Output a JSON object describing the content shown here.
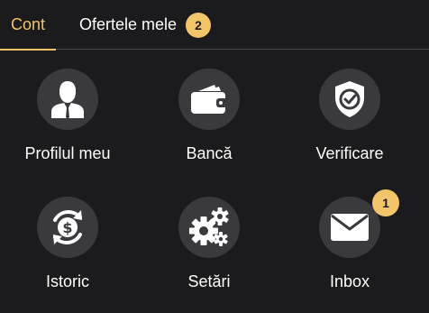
{
  "tabs": {
    "active": {
      "label": "Cont"
    },
    "offers": {
      "label": "Ofertele mele",
      "badge": "2"
    }
  },
  "colors": {
    "accent": "#f3c56b",
    "background": "#1b1b1d",
    "icon_circle": "#3a3a3e",
    "text": "#ffffff"
  },
  "menu": {
    "profile": {
      "label": "Profilul meu",
      "icon": "user-icon"
    },
    "bank": {
      "label": "Bancă",
      "icon": "wallet-icon"
    },
    "verify": {
      "label": "Verificare",
      "icon": "shield-check-icon"
    },
    "history": {
      "label": "Istoric",
      "icon": "dollar-refresh-icon"
    },
    "settings": {
      "label": "Setări",
      "icon": "gears-icon"
    },
    "inbox": {
      "label": "Inbox",
      "icon": "envelope-icon",
      "badge": "1"
    }
  }
}
